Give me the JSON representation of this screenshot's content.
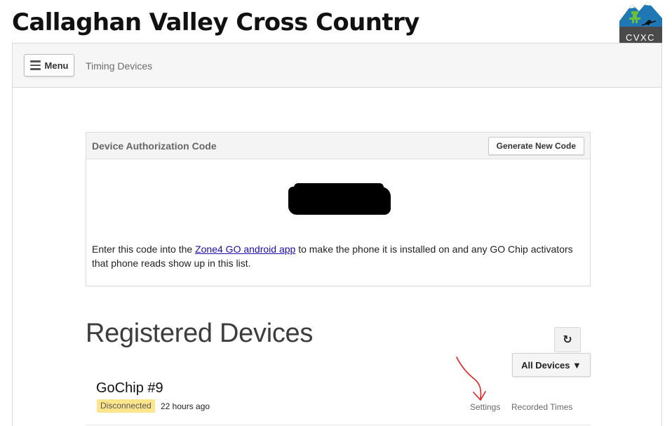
{
  "header": {
    "site_title": "Callaghan Valley Cross Country",
    "logo_text": "CVXC"
  },
  "topbar": {
    "menu_label": "Menu",
    "breadcrumb": "Timing Devices"
  },
  "auth_panel": {
    "title": "Device Authorization Code",
    "generate_button": "Generate New Code",
    "text_before_link": "Enter this code into the ",
    "link_text": "Zone4 GO android app",
    "text_after_link": " to make the phone it is installed on and any GO Chip activators that phone reads show up in this list."
  },
  "registered": {
    "title": "Registered Devices",
    "refresh_glyph": "↻",
    "filter_label": "All Devices ▼"
  },
  "devices": [
    {
      "name": "GoChip #9",
      "status": "Disconnected",
      "last_seen": "22 hours ago",
      "settings_label": "Settings",
      "times_label": "Recorded Times"
    }
  ],
  "colors": {
    "status_warning": "#fde58b",
    "link": "#1a0dab",
    "annotation": "#e02020"
  }
}
